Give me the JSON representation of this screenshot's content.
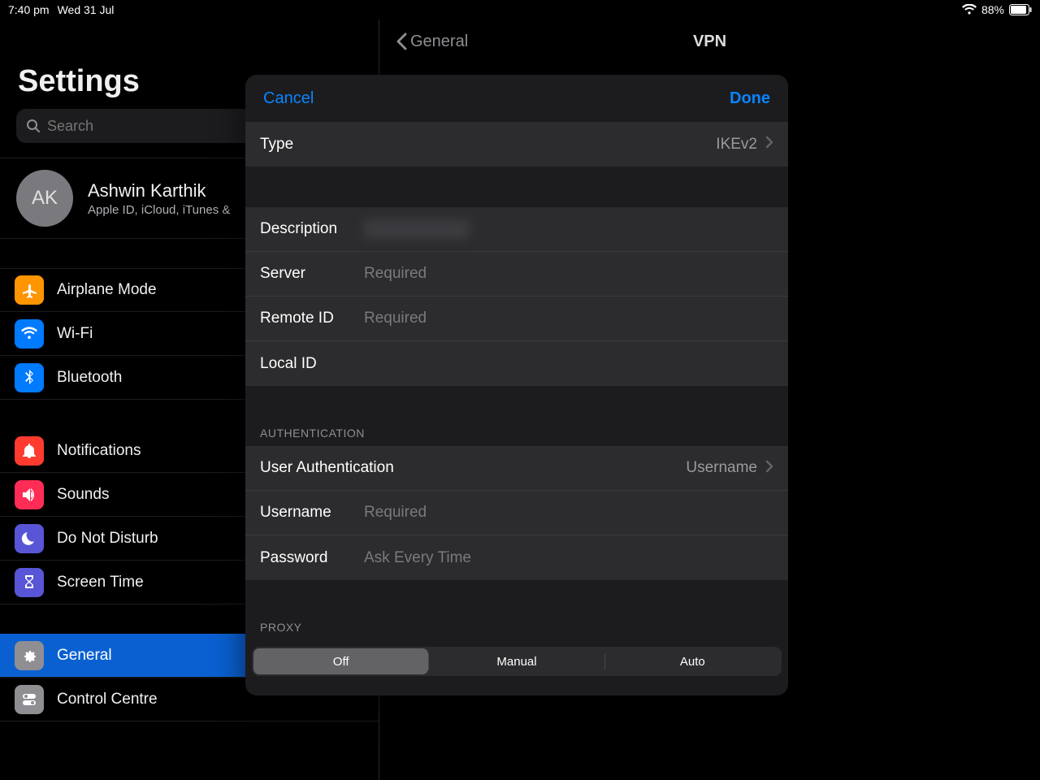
{
  "status": {
    "time": "7:40 pm",
    "date": "Wed 31 Jul",
    "battery_pct": "88%"
  },
  "sidebar": {
    "title": "Settings",
    "search_placeholder": "Search",
    "account": {
      "initials": "AK",
      "name": "Ashwin Karthik",
      "sub": "Apple ID, iCloud, iTunes &"
    },
    "groups": [
      {
        "items": [
          {
            "key": "airplane",
            "label": "Airplane Mode",
            "icon": "airplane",
            "bg": "bg-orange"
          },
          {
            "key": "wifi",
            "label": "Wi-Fi",
            "icon": "wifi",
            "bg": "bg-blue"
          },
          {
            "key": "bt",
            "label": "Bluetooth",
            "icon": "bluetooth",
            "bg": "bg-blue"
          }
        ]
      },
      {
        "items": [
          {
            "key": "notif",
            "label": "Notifications",
            "icon": "bell",
            "bg": "bg-red"
          },
          {
            "key": "sounds",
            "label": "Sounds",
            "icon": "sound",
            "bg": "bg-pink"
          },
          {
            "key": "dnd",
            "label": "Do Not Disturb",
            "icon": "moon",
            "bg": "bg-purple"
          },
          {
            "key": "screen",
            "label": "Screen Time",
            "icon": "hourglass",
            "bg": "bg-indigo"
          }
        ]
      },
      {
        "items": [
          {
            "key": "general",
            "label": "General",
            "icon": "gear",
            "bg": "bg-grey",
            "selected": true
          },
          {
            "key": "control",
            "label": "Control Centre",
            "icon": "toggles",
            "bg": "bg-grey"
          }
        ]
      }
    ]
  },
  "detail": {
    "back_label": "General",
    "title": "VPN"
  },
  "modal": {
    "cancel": "Cancel",
    "done": "Done",
    "type_row": {
      "label": "Type",
      "value": "IKEv2"
    },
    "fields": [
      {
        "label": "Description",
        "value": "",
        "placeholder": "",
        "blurred": true
      },
      {
        "label": "Server",
        "value": "",
        "placeholder": "Required"
      },
      {
        "label": "Remote ID",
        "value": "",
        "placeholder": "Required"
      },
      {
        "label": "Local ID",
        "value": "",
        "placeholder": ""
      }
    ],
    "auth_heading": "AUTHENTICATION",
    "user_auth_row": {
      "label": "User Authentication",
      "value": "Username"
    },
    "auth_fields": [
      {
        "label": "Username",
        "value": "",
        "placeholder": "Required"
      },
      {
        "label": "Password",
        "value": "",
        "placeholder": "Ask Every Time"
      }
    ],
    "proxy_heading": "PROXY",
    "proxy_options": [
      "Off",
      "Manual",
      "Auto"
    ],
    "proxy_selected": 0
  }
}
